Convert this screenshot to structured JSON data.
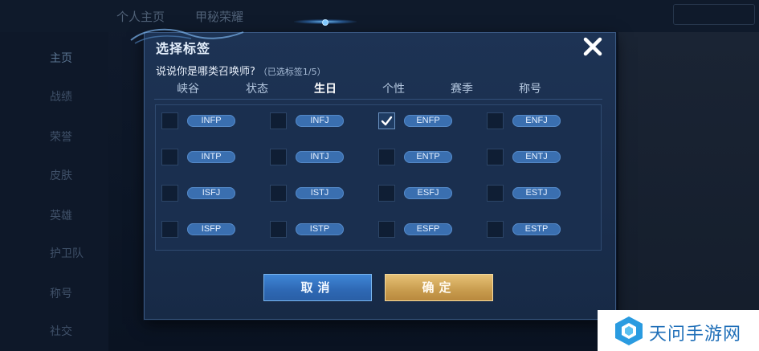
{
  "background": {
    "top_tabs": [
      "个人主页",
      "甲秘荣耀"
    ],
    "side_items": [
      "主页",
      "战绩",
      "荣誉",
      "皮肤",
      "英雄",
      "护卫队",
      "称号",
      "社交"
    ]
  },
  "modal": {
    "title": "选择标签",
    "question": "说说你是哪类召唤师?",
    "selected_count": "（已选标签1/5）",
    "tabs": [
      {
        "label": "峡谷",
        "active": false
      },
      {
        "label": "状态",
        "active": false
      },
      {
        "label": "生日",
        "active": true
      },
      {
        "label": "个性",
        "active": false
      },
      {
        "label": "赛季",
        "active": false
      },
      {
        "label": "称号",
        "active": false
      }
    ],
    "tags": [
      {
        "label": "INFP",
        "checked": false
      },
      {
        "label": "INFJ",
        "checked": false
      },
      {
        "label": "ENFP",
        "checked": true
      },
      {
        "label": "ENFJ",
        "checked": false
      },
      {
        "label": "INTP",
        "checked": false
      },
      {
        "label": "INTJ",
        "checked": false
      },
      {
        "label": "ENTP",
        "checked": false
      },
      {
        "label": "ENTJ",
        "checked": false
      },
      {
        "label": "ISFJ",
        "checked": false
      },
      {
        "label": "ISTJ",
        "checked": false
      },
      {
        "label": "ESFJ",
        "checked": false
      },
      {
        "label": "ESTJ",
        "checked": false
      },
      {
        "label": "ISFP",
        "checked": false
      },
      {
        "label": "ISTP",
        "checked": false
      },
      {
        "label": "ESFP",
        "checked": false
      },
      {
        "label": "ESTP",
        "checked": false
      }
    ],
    "cancel_label": "取消",
    "confirm_label": "确定"
  },
  "watermark": {
    "text": "天问手游网"
  },
  "colors": {
    "accent_blue": "#3a6fb0",
    "confirm_gold": "#c89c4e",
    "cancel_blue": "#2e68b4"
  }
}
